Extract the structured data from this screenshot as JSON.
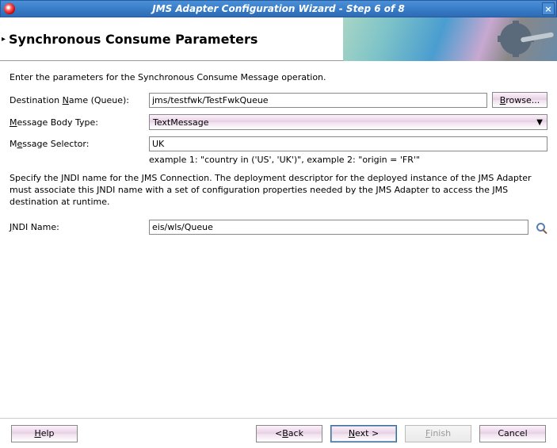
{
  "window": {
    "title": "JMS Adapter Configuration Wizard - Step 6 of 8"
  },
  "banner": {
    "heading": "Synchronous Consume Parameters"
  },
  "intro": "Enter the parameters for the Synchronous Consume Message operation.",
  "fields": {
    "destination": {
      "label_pre": "Destination ",
      "label_ul": "N",
      "label_post": "ame (Queue):",
      "value": "jms/testfwk/TestFwkQueue",
      "browse_label": "Browse..."
    },
    "bodyType": {
      "label_ul": "M",
      "label_post": "essage Body Type:",
      "value": "TextMessage"
    },
    "selector": {
      "label_pre": "M",
      "label_ul": "e",
      "label_post": "ssage Selector:",
      "value": "UK",
      "hint": "example 1: \"country in ('US', 'UK')\", example 2: \"origin = 'FR'\""
    },
    "jndiDesc": "Specify the JNDI name for the JMS Connection.  The deployment descriptor for the deployed instance of the JMS Adapter must associate this JNDI name with a set of configuration properties needed by the JMS Adapter to access the JMS destination at runtime.",
    "jndi": {
      "label_ul": "J",
      "label_post": "NDI Name:",
      "value": "eis/wls/Queue"
    }
  },
  "footer": {
    "help": "Help",
    "back": "< Back",
    "next": "Next >",
    "finish": "Finish",
    "cancel": "Cancel"
  }
}
